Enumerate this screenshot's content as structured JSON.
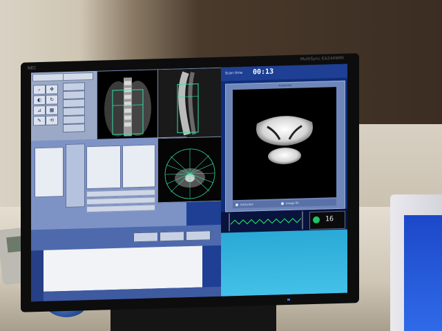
{
  "monitor": {
    "brand": "NEC",
    "model": "MultiSync EA244WMi"
  },
  "scan": {
    "time_label": "Scan time",
    "time_value": "00:13",
    "panel_title": "Autoview",
    "options": [
      "Autoview",
      "Image fill"
    ]
  },
  "vitals": {
    "value": "16"
  },
  "colors": {
    "ui_blue": "#1e3f93",
    "ecg_green": "#2df26b",
    "scan_background": "#000000",
    "accent_cyan": "#3db6e1"
  }
}
